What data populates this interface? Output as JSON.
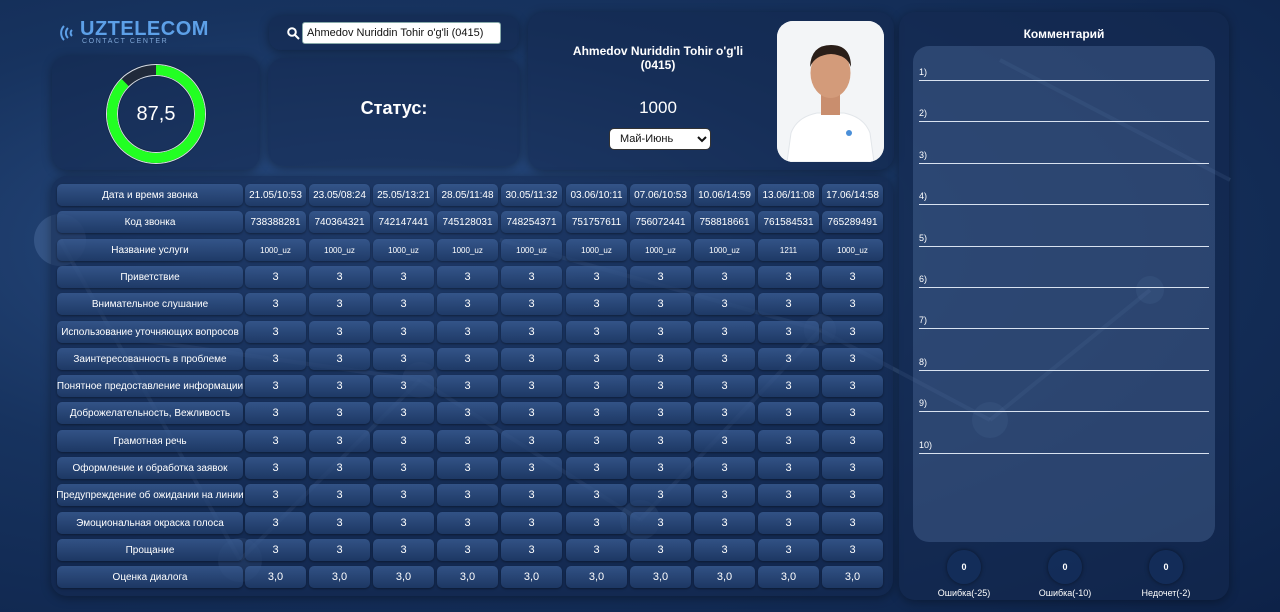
{
  "logo": {
    "text": "UZTELECOM",
    "subtitle": "CONTACT CENTER"
  },
  "score": {
    "value": "87,5",
    "fraction": 0.875,
    "color": "#22ff22"
  },
  "search": {
    "value": "Ahmedov Nuriddin Tohir o'g'li (0415)"
  },
  "status": {
    "label": "Статус:"
  },
  "operator": {
    "name": "Ahmedov Nuriddin Tohir o'g'li (0415)",
    "number": "1000",
    "period": "Май-Июнь"
  },
  "table": {
    "rows": [
      {
        "label": "Дата и время звонка",
        "type": "header",
        "cells": [
          "21.05/10:53",
          "23.05/08:24",
          "25.05/13:21",
          "28.05/11:48",
          "30.05/11:32",
          "03.06/10:11",
          "07.06/10:53",
          "10.06/14:59",
          "13.06/11:08",
          "17.06/14:58"
        ]
      },
      {
        "label": "Код звонка",
        "type": "header",
        "cells": [
          "738388281",
          "740364321",
          "742147441",
          "745128031",
          "748254371",
          "751757611",
          "756072441",
          "758818661",
          "761584531",
          "765289491"
        ]
      },
      {
        "label": "Название услуги",
        "type": "small",
        "cells": [
          "1000_uz",
          "1000_uz",
          "1000_uz",
          "1000_uz",
          "1000_uz",
          "1000_uz",
          "1000_uz",
          "1000_uz",
          "1211",
          "1000_uz"
        ]
      },
      {
        "label": "Приветствие",
        "type": "score",
        "cells": [
          "3",
          "3",
          "3",
          "3",
          "3",
          "3",
          "3",
          "3",
          "3",
          "3"
        ]
      },
      {
        "label": "Внимательное слушание",
        "type": "score",
        "cells": [
          "3",
          "3",
          "3",
          "3",
          "3",
          "3",
          "3",
          "3",
          "3",
          "3"
        ]
      },
      {
        "label": "Использование уточняющих вопросов",
        "type": "score",
        "cells": [
          "3",
          "3",
          "3",
          "3",
          "3",
          "3",
          "3",
          "3",
          "3",
          "3"
        ]
      },
      {
        "label": "Заинтересованность в проблеме",
        "type": "score",
        "cells": [
          "3",
          "3",
          "3",
          "3",
          "3",
          "3",
          "3",
          "3",
          "3",
          "3"
        ]
      },
      {
        "label": "Понятное предоставление информации",
        "type": "score",
        "cells": [
          "3",
          "3",
          "3",
          "3",
          "3",
          "3",
          "3",
          "3",
          "3",
          "3"
        ]
      },
      {
        "label": "Доброжелательность, Вежливость",
        "type": "score",
        "cells": [
          "3",
          "3",
          "3",
          "3",
          "3",
          "3",
          "3",
          "3",
          "3",
          "3"
        ]
      },
      {
        "label": "Грамотная речь",
        "type": "score",
        "cells": [
          "3",
          "3",
          "3",
          "3",
          "3",
          "3",
          "3",
          "3",
          "3",
          "3"
        ]
      },
      {
        "label": "Оформление и обработка заявок",
        "type": "score",
        "cells": [
          "3",
          "3",
          "3",
          "3",
          "3",
          "3",
          "3",
          "3",
          "3",
          "3"
        ]
      },
      {
        "label": "Предупреждение об ожидании на линии",
        "type": "score",
        "cells": [
          "3",
          "3",
          "3",
          "3",
          "3",
          "3",
          "3",
          "3",
          "3",
          "3"
        ]
      },
      {
        "label": "Эмоциональная окраска голоса",
        "type": "score",
        "cells": [
          "3",
          "3",
          "3",
          "3",
          "3",
          "3",
          "3",
          "3",
          "3",
          "3"
        ]
      },
      {
        "label": "Прощание",
        "type": "score",
        "cells": [
          "3",
          "3",
          "3",
          "3",
          "3",
          "3",
          "3",
          "3",
          "3",
          "3"
        ]
      },
      {
        "label": "Оценка диалога",
        "type": "score",
        "cells": [
          "3,0",
          "3,0",
          "3,0",
          "3,0",
          "3,0",
          "3,0",
          "3,0",
          "3,0",
          "3,0",
          "3,0"
        ]
      }
    ]
  },
  "comments": {
    "title": "Комментарий",
    "lines": [
      "1)",
      "2)",
      "3)",
      "4)",
      "5)",
      "6)",
      "7)",
      "8)",
      "9)",
      "10)"
    ]
  },
  "counters": [
    {
      "value": "0",
      "label": "Ошибка(-25)"
    },
    {
      "value": "0",
      "label": "Ошибка(-10)"
    },
    {
      "value": "0",
      "label": "Недочет(-2)"
    }
  ]
}
